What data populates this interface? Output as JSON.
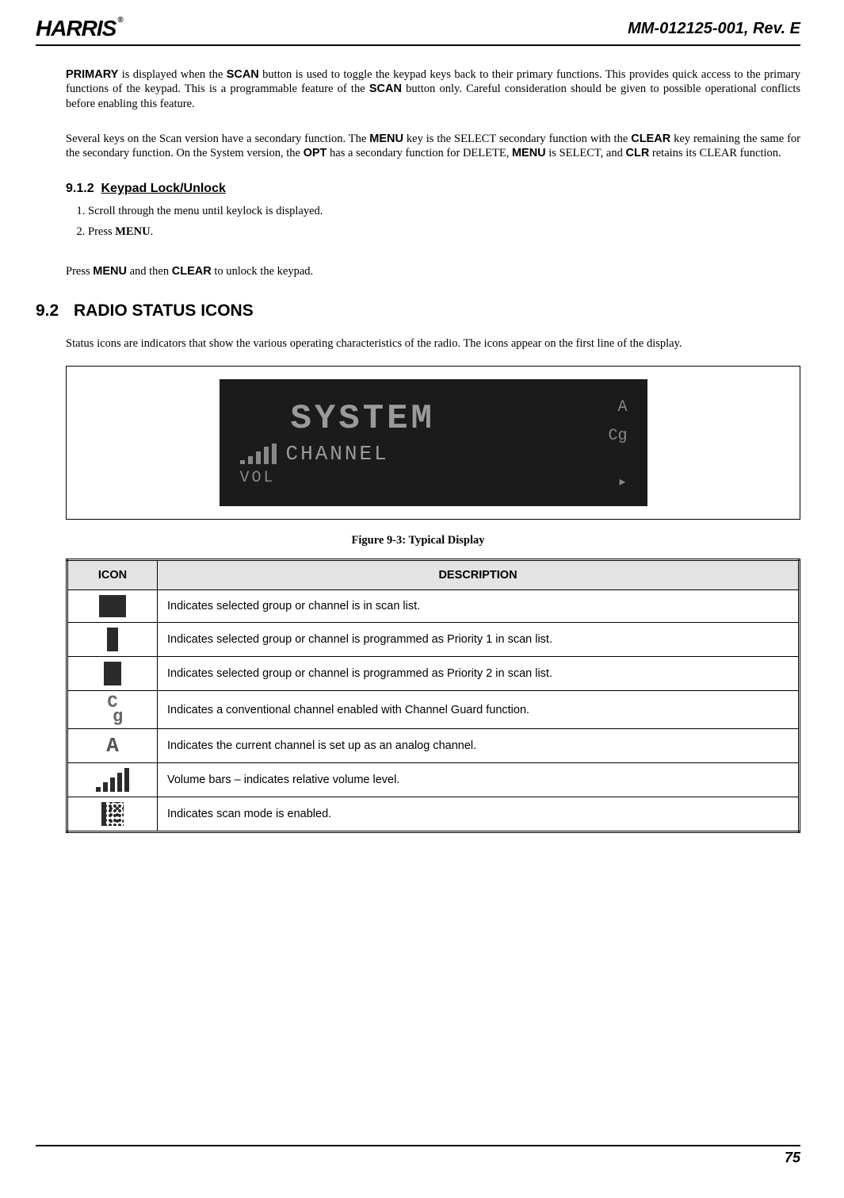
{
  "header": {
    "logo_text": "HARRIS",
    "logo_reg": "®",
    "doc_id": "MM-012125-001, Rev. E"
  },
  "para1_pre": "PRIMARY",
  "para1_mid1": " is displayed when the ",
  "para1_b1": "SCAN",
  "para1_mid2": " button is used to toggle the keypad keys back to their primary functions. This provides quick access to the primary functions of the keypad. This is a programmable feature of the ",
  "para1_b2": "SCAN",
  "para1_mid3": " button only. Careful consideration should be given to possible operational conflicts before enabling this feature.",
  "para2_pre": "Several keys on the Scan version have a secondary function. The ",
  "para2_b1": "MENU",
  "para2_m1": " key is the SELECT secondary function with the ",
  "para2_b2": "CLEAR",
  "para2_m2": " key remaining the same for the secondary function. On the System version, the ",
  "para2_b3": "OPT",
  "para2_m3": " has a secondary function for DELETE, ",
  "para2_b4": "MENU",
  "para2_m4": " is SELECT, and ",
  "para2_b5": "CLR",
  "para2_m5": " retains its CLEAR function.",
  "sub912_num": "9.1.2",
  "sub912_title": "Keypad Lock/Unlock",
  "steps": [
    "Scroll through the menu until keylock is displayed.",
    "Press "
  ],
  "step2_bold": "MENU",
  "step2_post": ".",
  "unlock_pre": "Press ",
  "unlock_b1": "MENU",
  "unlock_m1": " and then ",
  "unlock_b2": "CLEAR",
  "unlock_post": " to unlock the keypad.",
  "sec92_num": "9.2",
  "sec92_title": "RADIO STATUS ICONS",
  "sec92_body": "Status icons are indicators that show the various operating characteristics of the radio.  The icons appear on the first line of the display.",
  "lcd": {
    "line1": "SYSTEM",
    "line2": "CHANNEL",
    "line3": "VOL",
    "side_top": "A",
    "side_mid": "Cg",
    "side_bot": "▸"
  },
  "fig_caption": "Figure 9-3: Typical Display",
  "table": {
    "h_icon": "ICON",
    "h_desc": "DESCRIPTION",
    "rows": [
      "Indicates selected group or channel is in scan list.",
      "Indicates selected group or channel is programmed as Priority 1 in scan list.",
      "Indicates selected group or channel is programmed as Priority 2 in scan list.",
      "Indicates a conventional channel enabled with Channel Guard function.",
      "Indicates the current channel is set up as an analog channel.",
      "Volume bars – indicates relative volume level.",
      "Indicates scan mode is enabled."
    ]
  },
  "footer_page": "75"
}
